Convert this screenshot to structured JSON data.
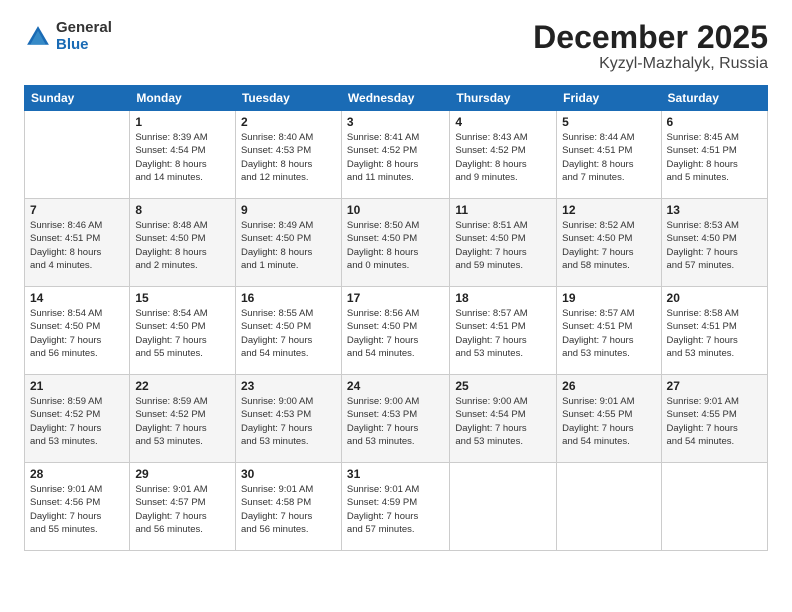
{
  "header": {
    "logo_general": "General",
    "logo_blue": "Blue",
    "month_title": "December 2025",
    "location": "Kyzyl-Mazhalyk, Russia"
  },
  "days_of_week": [
    "Sunday",
    "Monday",
    "Tuesday",
    "Wednesday",
    "Thursday",
    "Friday",
    "Saturday"
  ],
  "weeks": [
    [
      {
        "num": "",
        "info": ""
      },
      {
        "num": "1",
        "info": "Sunrise: 8:39 AM\nSunset: 4:54 PM\nDaylight: 8 hours\nand 14 minutes."
      },
      {
        "num": "2",
        "info": "Sunrise: 8:40 AM\nSunset: 4:53 PM\nDaylight: 8 hours\nand 12 minutes."
      },
      {
        "num": "3",
        "info": "Sunrise: 8:41 AM\nSunset: 4:52 PM\nDaylight: 8 hours\nand 11 minutes."
      },
      {
        "num": "4",
        "info": "Sunrise: 8:43 AM\nSunset: 4:52 PM\nDaylight: 8 hours\nand 9 minutes."
      },
      {
        "num": "5",
        "info": "Sunrise: 8:44 AM\nSunset: 4:51 PM\nDaylight: 8 hours\nand 7 minutes."
      },
      {
        "num": "6",
        "info": "Sunrise: 8:45 AM\nSunset: 4:51 PM\nDaylight: 8 hours\nand 5 minutes."
      }
    ],
    [
      {
        "num": "7",
        "info": "Sunrise: 8:46 AM\nSunset: 4:51 PM\nDaylight: 8 hours\nand 4 minutes."
      },
      {
        "num": "8",
        "info": "Sunrise: 8:48 AM\nSunset: 4:50 PM\nDaylight: 8 hours\nand 2 minutes."
      },
      {
        "num": "9",
        "info": "Sunrise: 8:49 AM\nSunset: 4:50 PM\nDaylight: 8 hours\nand 1 minute."
      },
      {
        "num": "10",
        "info": "Sunrise: 8:50 AM\nSunset: 4:50 PM\nDaylight: 8 hours\nand 0 minutes."
      },
      {
        "num": "11",
        "info": "Sunrise: 8:51 AM\nSunset: 4:50 PM\nDaylight: 7 hours\nand 59 minutes."
      },
      {
        "num": "12",
        "info": "Sunrise: 8:52 AM\nSunset: 4:50 PM\nDaylight: 7 hours\nand 58 minutes."
      },
      {
        "num": "13",
        "info": "Sunrise: 8:53 AM\nSunset: 4:50 PM\nDaylight: 7 hours\nand 57 minutes."
      }
    ],
    [
      {
        "num": "14",
        "info": "Sunrise: 8:54 AM\nSunset: 4:50 PM\nDaylight: 7 hours\nand 56 minutes."
      },
      {
        "num": "15",
        "info": "Sunrise: 8:54 AM\nSunset: 4:50 PM\nDaylight: 7 hours\nand 55 minutes."
      },
      {
        "num": "16",
        "info": "Sunrise: 8:55 AM\nSunset: 4:50 PM\nDaylight: 7 hours\nand 54 minutes."
      },
      {
        "num": "17",
        "info": "Sunrise: 8:56 AM\nSunset: 4:50 PM\nDaylight: 7 hours\nand 54 minutes."
      },
      {
        "num": "18",
        "info": "Sunrise: 8:57 AM\nSunset: 4:51 PM\nDaylight: 7 hours\nand 53 minutes."
      },
      {
        "num": "19",
        "info": "Sunrise: 8:57 AM\nSunset: 4:51 PM\nDaylight: 7 hours\nand 53 minutes."
      },
      {
        "num": "20",
        "info": "Sunrise: 8:58 AM\nSunset: 4:51 PM\nDaylight: 7 hours\nand 53 minutes."
      }
    ],
    [
      {
        "num": "21",
        "info": "Sunrise: 8:59 AM\nSunset: 4:52 PM\nDaylight: 7 hours\nand 53 minutes."
      },
      {
        "num": "22",
        "info": "Sunrise: 8:59 AM\nSunset: 4:52 PM\nDaylight: 7 hours\nand 53 minutes."
      },
      {
        "num": "23",
        "info": "Sunrise: 9:00 AM\nSunset: 4:53 PM\nDaylight: 7 hours\nand 53 minutes."
      },
      {
        "num": "24",
        "info": "Sunrise: 9:00 AM\nSunset: 4:53 PM\nDaylight: 7 hours\nand 53 minutes."
      },
      {
        "num": "25",
        "info": "Sunrise: 9:00 AM\nSunset: 4:54 PM\nDaylight: 7 hours\nand 53 minutes."
      },
      {
        "num": "26",
        "info": "Sunrise: 9:01 AM\nSunset: 4:55 PM\nDaylight: 7 hours\nand 54 minutes."
      },
      {
        "num": "27",
        "info": "Sunrise: 9:01 AM\nSunset: 4:55 PM\nDaylight: 7 hours\nand 54 minutes."
      }
    ],
    [
      {
        "num": "28",
        "info": "Sunrise: 9:01 AM\nSunset: 4:56 PM\nDaylight: 7 hours\nand 55 minutes."
      },
      {
        "num": "29",
        "info": "Sunrise: 9:01 AM\nSunset: 4:57 PM\nDaylight: 7 hours\nand 56 minutes."
      },
      {
        "num": "30",
        "info": "Sunrise: 9:01 AM\nSunset: 4:58 PM\nDaylight: 7 hours\nand 56 minutes."
      },
      {
        "num": "31",
        "info": "Sunrise: 9:01 AM\nSunset: 4:59 PM\nDaylight: 7 hours\nand 57 minutes."
      },
      {
        "num": "",
        "info": ""
      },
      {
        "num": "",
        "info": ""
      },
      {
        "num": "",
        "info": ""
      }
    ]
  ]
}
